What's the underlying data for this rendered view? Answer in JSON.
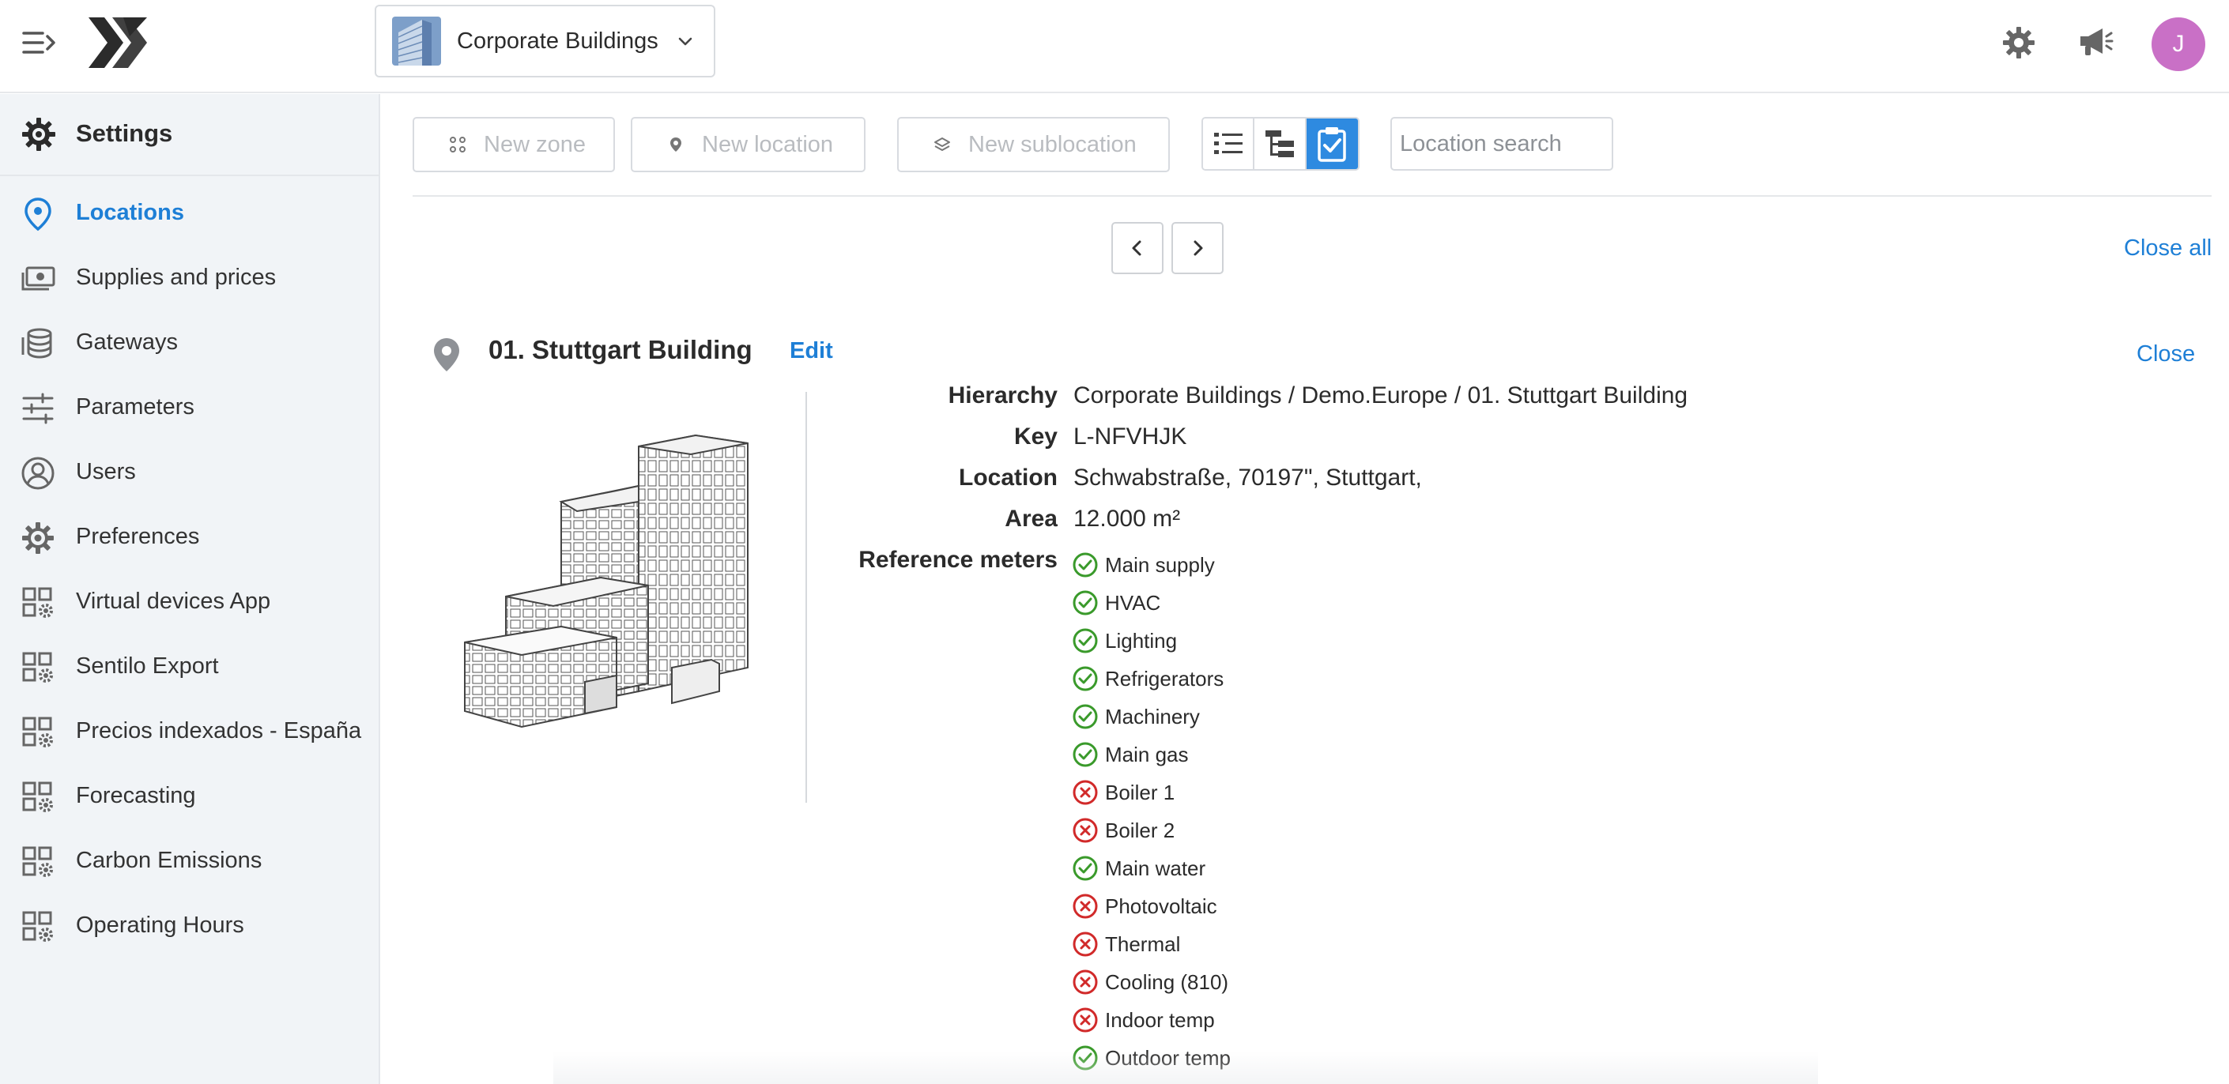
{
  "topbar": {
    "building_selector": "Corporate Buildings",
    "avatar_initial": "J"
  },
  "sidebar": {
    "title": "Settings",
    "items": [
      {
        "label": "Locations",
        "icon": "location-pin-icon",
        "active": true
      },
      {
        "label": "Supplies and prices",
        "icon": "money-icon"
      },
      {
        "label": "Gateways",
        "icon": "database-icon"
      },
      {
        "label": "Parameters",
        "icon": "sliders-icon"
      },
      {
        "label": "Users",
        "icon": "user-icon"
      },
      {
        "label": "Preferences",
        "icon": "gear-icon"
      },
      {
        "label": "Virtual devices App",
        "icon": "app-gear-icon"
      },
      {
        "label": "Sentilo Export",
        "icon": "app-gear-icon"
      },
      {
        "label": "Precios indexados - España",
        "icon": "app-gear-icon"
      },
      {
        "label": "Forecasting",
        "icon": "app-gear-icon"
      },
      {
        "label": "Carbon Emissions",
        "icon": "app-gear-icon"
      },
      {
        "label": "Operating Hours",
        "icon": "app-gear-icon"
      }
    ]
  },
  "toolbar": {
    "new_zone": "New zone",
    "new_location": "New location",
    "new_sublocation": "New sublocation",
    "search_placeholder": "Location search"
  },
  "main": {
    "close_all": "Close all",
    "location": {
      "title": "01. Stuttgart Building",
      "edit": "Edit",
      "close": "Close",
      "properties": [
        {
          "label": "Hierarchy",
          "value": "Corporate Buildings / Demo.Europe / 01. Stuttgart Building"
        },
        {
          "label": "Key",
          "value": "L-NFVHJK"
        },
        {
          "label": "Location",
          "value": "Schwabstraße, 70197\", Stuttgart,"
        },
        {
          "label": "Area",
          "value": "12.000 m²"
        }
      ],
      "reference_meters_label": "Reference meters",
      "meters": [
        {
          "name": "Main supply",
          "ok": true
        },
        {
          "name": "HVAC",
          "ok": true
        },
        {
          "name": "Lighting",
          "ok": true
        },
        {
          "name": "Refrigerators",
          "ok": true
        },
        {
          "name": "Machinery",
          "ok": true
        },
        {
          "name": "Main gas",
          "ok": true
        },
        {
          "name": "Boiler 1",
          "ok": false
        },
        {
          "name": "Boiler 2",
          "ok": false
        },
        {
          "name": "Main water",
          "ok": true
        },
        {
          "name": "Photovoltaic",
          "ok": false
        },
        {
          "name": "Thermal",
          "ok": false
        },
        {
          "name": "Cooling (810)",
          "ok": false
        },
        {
          "name": "Indoor temp",
          "ok": false
        },
        {
          "name": "Outdoor temp",
          "ok": true
        }
      ]
    }
  },
  "colors": {
    "accent": "#1e7fd6",
    "ok": "#3a9a2b",
    "error": "#d12a2a",
    "avatar": "#c970c6",
    "sidebar_bg": "#f1f4f7"
  }
}
